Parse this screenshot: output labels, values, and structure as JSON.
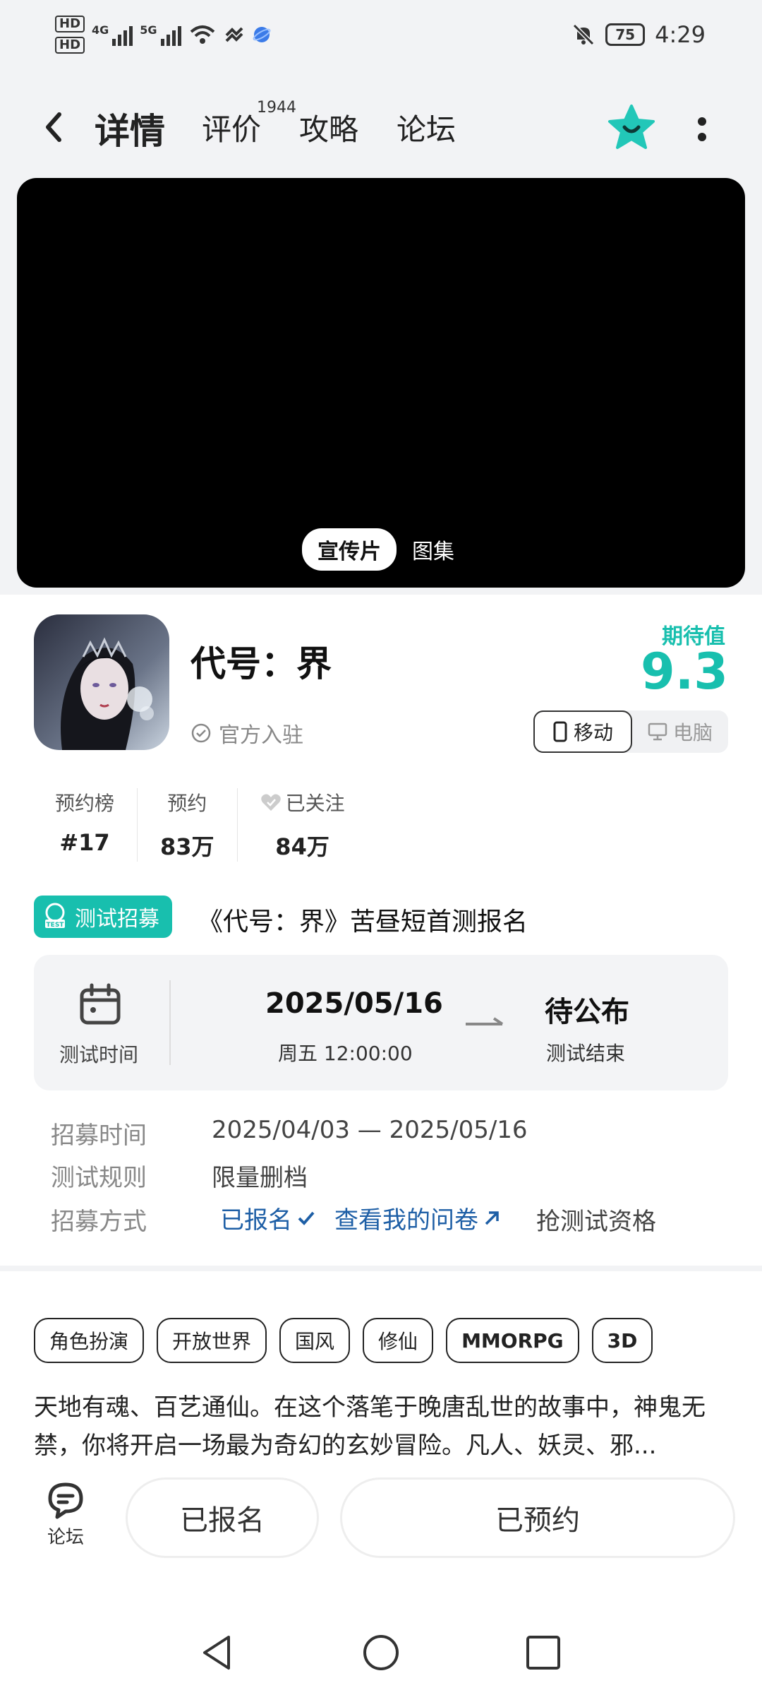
{
  "status_bar": {
    "hd1": "HD",
    "hd2": "HD",
    "net1": "4G",
    "net2": "5G",
    "battery": "75",
    "time": "4:29"
  },
  "nav": {
    "tabs": [
      "详情",
      "评价",
      "攻略",
      "论坛"
    ],
    "review_count": "1944",
    "accent": "#22c7b8"
  },
  "media": {
    "tabs": [
      "宣传片",
      "图集"
    ]
  },
  "game": {
    "title": "代号：界",
    "official": "官方入驻",
    "expect_label": "期待值",
    "expect_value": "9.3",
    "platforms": [
      "移动",
      "电脑"
    ]
  },
  "stats": [
    {
      "label": "预约榜",
      "value": "#17"
    },
    {
      "label": "预约",
      "value": "83万"
    },
    {
      "label": "已关注",
      "value": "84万"
    }
  ],
  "test": {
    "badge": "测试招募",
    "title": "《代号：界》苦昼短首测报名",
    "time_label": "测试时间",
    "start_date": "2025/05/16",
    "start_time": "周五  12:00:00",
    "end_label": "待公布",
    "end_sub": "测试结束"
  },
  "info": {
    "recruit_label": "招募时间",
    "recruit_value": "2025/04/03 — 2025/05/16",
    "rule_label": "测试规则",
    "rule_value": "限量删档",
    "method_label": "招募方式",
    "signed_link": "已报名",
    "survey_link": "查看我的问卷",
    "grab": "抢测试资格"
  },
  "tags": [
    "角色扮演",
    "开放世界",
    "国风",
    "修仙",
    "MMORPG",
    "3D"
  ],
  "description": "天地有魂、百艺通仙。在这个落笔于晚唐乱世的故事中，神鬼无禁，你将开启一场最为奇幻的玄妙冒险。凡人、妖灵、邪...",
  "bottom": {
    "forum": "论坛",
    "signed": "已报名",
    "reserved": "已预约"
  }
}
